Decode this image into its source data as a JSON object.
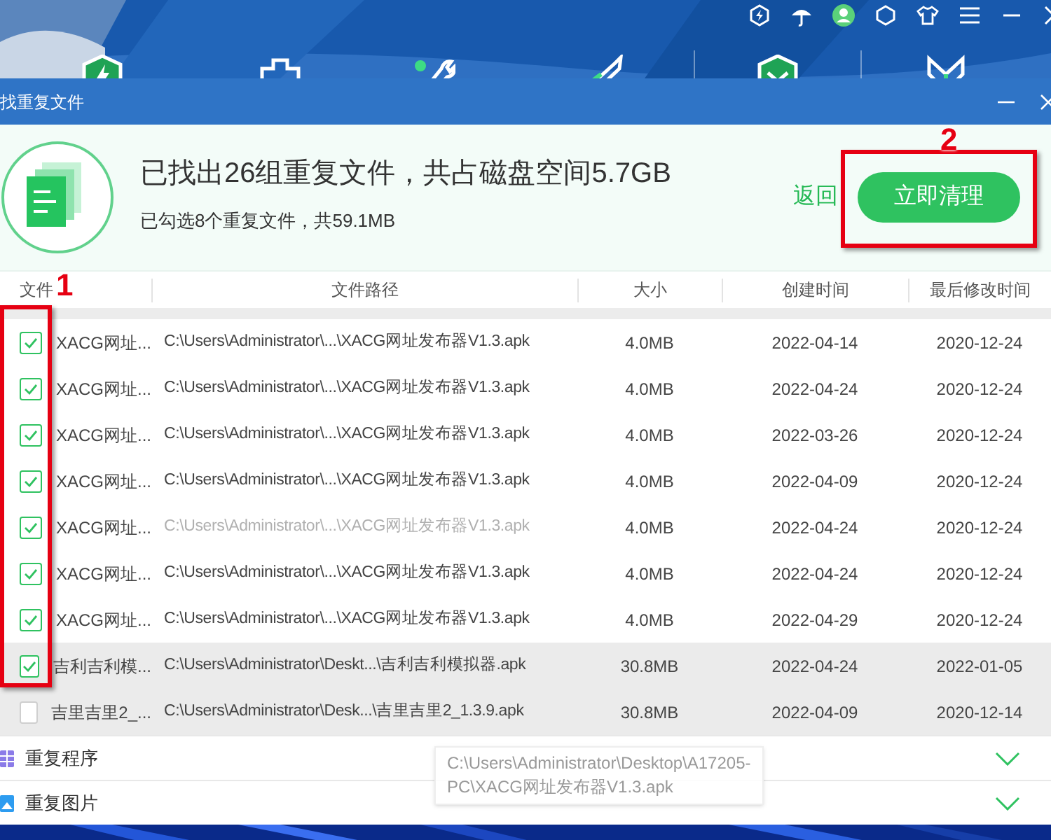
{
  "dialog": {
    "title": "找重复文件",
    "headline": "已找出26组重复文件，共占磁盘空间5.7GB",
    "summary": "已勾选8个重复文件，共59.1MB",
    "back_link": "返回",
    "clean_button": "立即清理"
  },
  "table": {
    "columns": [
      "文件",
      "文件路径",
      "大小",
      "创建时间",
      "最后修改时间"
    ],
    "rows": [
      {
        "checked": true,
        "hovered": false,
        "highlighted": false,
        "name": "XACG网址...",
        "path": "C:\\Users\\Administrator\\...\\XACG网址发布器V1.3.apk",
        "size": "4.0MB",
        "created": "2022-04-14",
        "modified": "2020-12-24"
      },
      {
        "checked": true,
        "hovered": false,
        "highlighted": false,
        "name": "XACG网址...",
        "path": "C:\\Users\\Administrator\\...\\XACG网址发布器V1.3.apk",
        "size": "4.0MB",
        "created": "2022-04-24",
        "modified": "2020-12-24"
      },
      {
        "checked": true,
        "hovered": false,
        "highlighted": false,
        "name": "XACG网址...",
        "path": "C:\\Users\\Administrator\\...\\XACG网址发布器V1.3.apk",
        "size": "4.0MB",
        "created": "2022-03-26",
        "modified": "2020-12-24"
      },
      {
        "checked": true,
        "hovered": false,
        "highlighted": false,
        "name": "XACG网址...",
        "path": "C:\\Users\\Administrator\\...\\XACG网址发布器V1.3.apk",
        "size": "4.0MB",
        "created": "2022-04-09",
        "modified": "2020-12-24"
      },
      {
        "checked": true,
        "hovered": true,
        "highlighted": false,
        "name": "XACG网址...",
        "path": "C:\\Users\\Administrator\\...\\XACG网址发布器V1.3.apk",
        "size": "4.0MB",
        "created": "2022-04-24",
        "modified": "2020-12-24"
      },
      {
        "checked": true,
        "hovered": false,
        "highlighted": false,
        "name": "XACG网址...",
        "path": "C:\\Users\\Administrator\\...\\XACG网址发布器V1.3.apk",
        "size": "4.0MB",
        "created": "2022-04-24",
        "modified": "2020-12-24"
      },
      {
        "checked": true,
        "hovered": false,
        "highlighted": false,
        "name": "XACG网址...",
        "path": "C:\\Users\\Administrator\\...\\XACG网址发布器V1.3.apk",
        "size": "4.0MB",
        "created": "2022-04-29",
        "modified": "2020-12-24"
      },
      {
        "checked": true,
        "hovered": false,
        "highlighted": true,
        "name": "吉利吉利模...",
        "path": "C:\\Users\\Administrator\\Deskt...\\吉利吉利模拟器.apk",
        "size": "30.8MB",
        "created": "2022-04-24",
        "modified": "2022-01-05"
      },
      {
        "checked": false,
        "hovered": false,
        "highlighted": true,
        "name": "吉里吉里2_...",
        "path": "C:\\Users\\Administrator\\Desk...\\吉里吉里2_1.3.9.apk",
        "size": "30.8MB",
        "created": "2022-04-09",
        "modified": "2020-12-14"
      }
    ]
  },
  "tooltip": {
    "lines": [
      "C:\\Users\\Administrator\\Desktop\\A17205-",
      "PC\\XACG网址发布器V1.3.apk"
    ]
  },
  "categories": [
    {
      "kind": "apps",
      "label": "重复程序",
      "expanded": false
    },
    {
      "kind": "images",
      "label": "重复图片",
      "expanded": false
    }
  ],
  "annotations": [
    {
      "label": "2"
    },
    {
      "label": "1"
    }
  ]
}
